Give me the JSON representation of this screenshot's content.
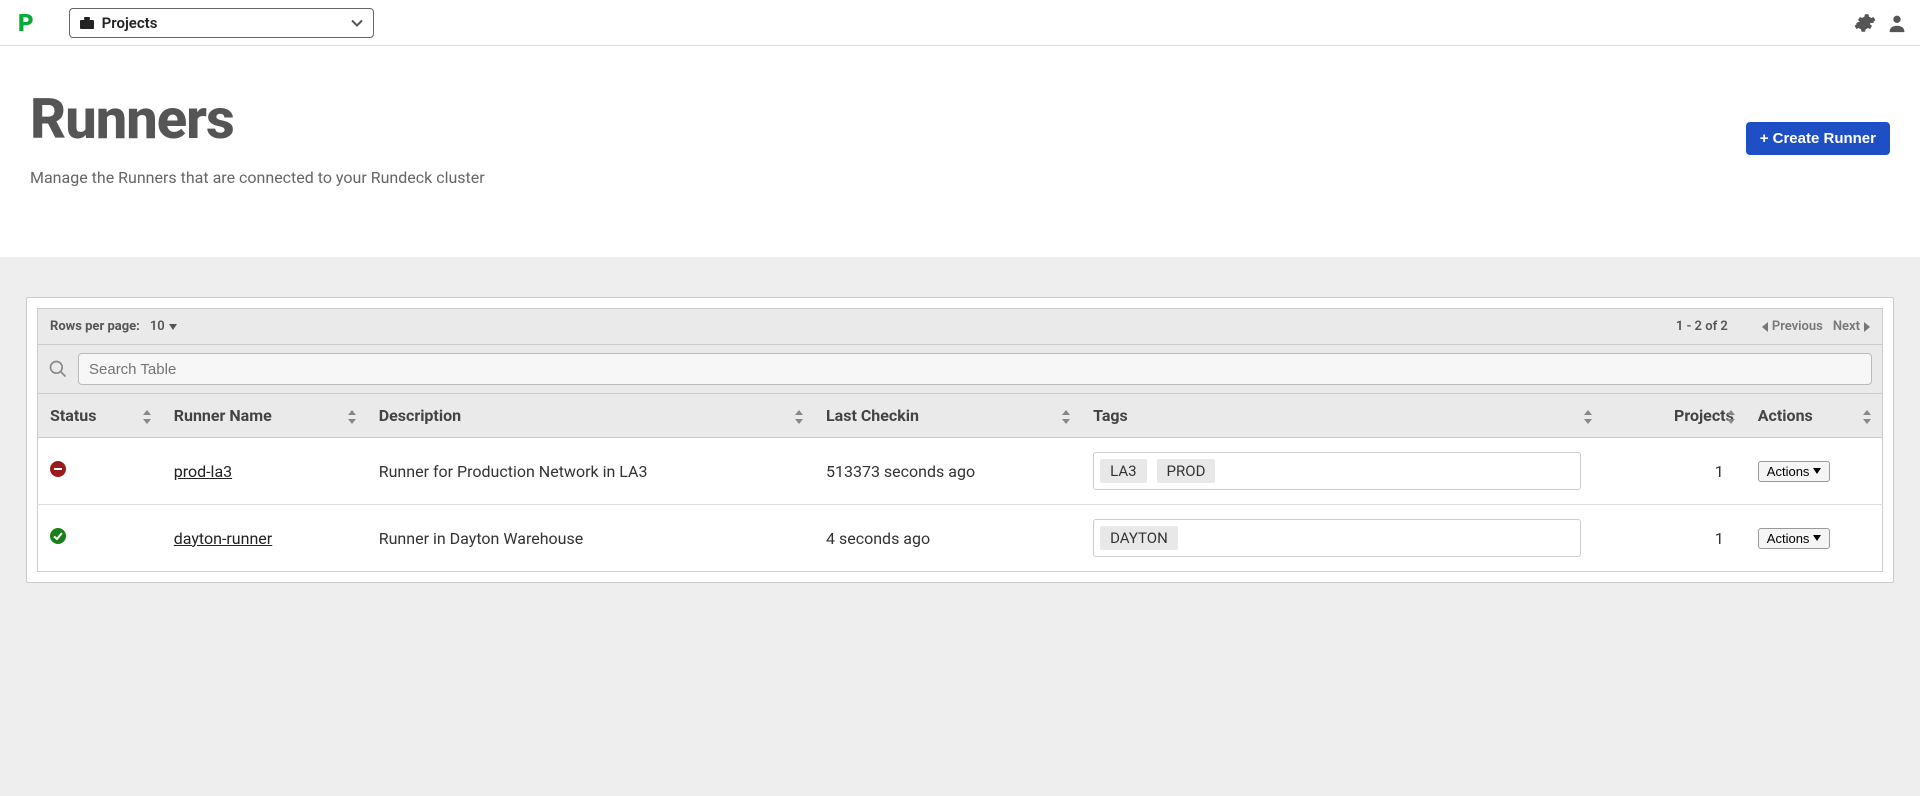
{
  "topbar": {
    "project_selector_label": "Projects"
  },
  "header": {
    "title": "Runners",
    "subtitle": "Manage the Runners that are connected to your Rundeck cluster",
    "create_button": "+ Create Runner"
  },
  "pager": {
    "rows_per_page_label": "Rows per page:",
    "rows_per_page_value": "10",
    "range_text": "1 - 2 of 2",
    "prev_label": "Previous",
    "next_label": "Next"
  },
  "search": {
    "placeholder": "Search Table"
  },
  "columns": {
    "status": "Status",
    "name": "Runner Name",
    "description": "Description",
    "last_checkin": "Last Checkin",
    "tags": "Tags",
    "projects": "Projects",
    "actions": "Actions"
  },
  "rows": [
    {
      "status": "down",
      "name": "prod-la3",
      "description": "Runner for Production Network in LA3",
      "last_checkin": "513373 seconds ago",
      "tags": [
        "LA3",
        "PROD"
      ],
      "projects": "1",
      "actions_label": "Actions"
    },
    {
      "status": "up",
      "name": "dayton-runner",
      "description": "Runner in Dayton Warehouse",
      "last_checkin": "4 seconds ago",
      "tags": [
        "DAYTON"
      ],
      "projects": "1",
      "actions_label": "Actions"
    }
  ]
}
